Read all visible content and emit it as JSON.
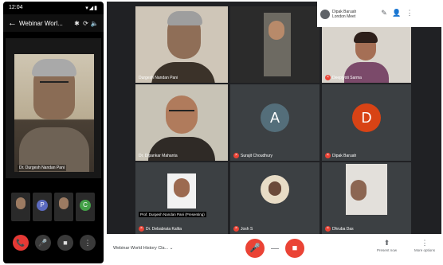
{
  "phone": {
    "status": {
      "time": "12:04",
      "icons": "▾◢▮"
    },
    "meeting_title": "Webinar Worl...",
    "back_glyph": "←",
    "icons": [
      "bluetooth-icon",
      "flip-camera-icon",
      "volume-icon"
    ],
    "glyphs": {
      "bluetooth": "✱",
      "flip": "⟳",
      "volume": "🔈",
      "mute_ctrl": "🎤",
      "video_ctrl": "■",
      "more_ctrl": "⋮",
      "end": "📞"
    },
    "speaker_name": "Dr. Durgesh Nandan Pani",
    "thumbs": [
      {
        "kind": "face"
      },
      {
        "kind": "avatar",
        "letter": "P",
        "color": "#5c6bc0"
      },
      {
        "kind": "face"
      },
      {
        "kind": "avatar",
        "letter": "C",
        "color": "#43a047"
      }
    ]
  },
  "meet": {
    "user_label": "Dipak Baruah\nLondon Meet",
    "top_icons": {
      "chat": "✎",
      "people": "👤",
      "info": "⋮"
    },
    "tiles": [
      {
        "label": "Durgesh Nandan Pani",
        "muted": false
      },
      {
        "label": "",
        "muted": false
      },
      {
        "label": "Deepjyoti Sarma",
        "muted": true
      },
      {
        "label": "Dr. Dipankar Mahanta",
        "muted": false
      },
      {
        "label": "Surajit Choudhury",
        "muted": true,
        "avatar": "A",
        "avatar_color": "#546e7a"
      },
      {
        "label": "Dipak Baruah",
        "muted": true,
        "avatar": "D",
        "avatar_color": "#d84315"
      },
      {
        "label": "Dr. Debabrata Kalita",
        "muted": true
      },
      {
        "label": "Josh S",
        "muted": true
      },
      {
        "label": "Dhruba Das",
        "muted": true
      }
    ],
    "presenter_caption": "Prof. Durgesh Nandan Pani (Presenting)",
    "bottom": {
      "meeting_name": "Webinar World History Cla... ⌄",
      "mic_glyph": "🎤",
      "cam_glyph": "■",
      "hangup_glyph": "—",
      "present_label": "Present now",
      "present_glyph": "⬆",
      "more_label": "More options",
      "more_glyph": "⋮"
    }
  }
}
